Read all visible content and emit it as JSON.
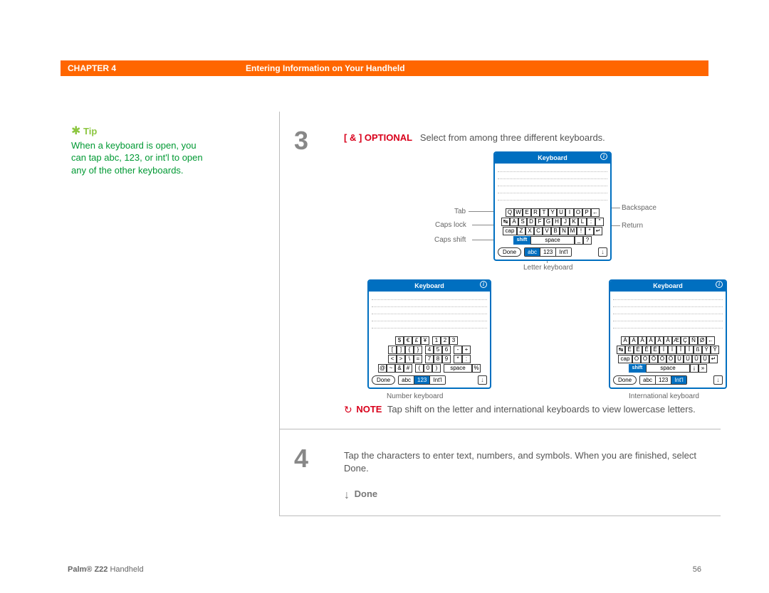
{
  "header": {
    "chapter": "CHAPTER 4",
    "title": "Entering Information on Your Handheld"
  },
  "tip": {
    "star": "✱",
    "label": "Tip",
    "text": "When a keyboard is open, you can tap abc, 123, or int'l to open any of the other keyboards."
  },
  "steps": {
    "s3": {
      "num": "3",
      "optional_tag": "[ & ]  OPTIONAL",
      "optional_text": "Select from among three different keyboards.",
      "callouts": {
        "tab": "Tab",
        "caps_lock": "Caps lock",
        "caps_shift": "Caps shift",
        "backspace": "Backspace",
        "return": "Return",
        "letter_kbd": "Letter keyboard",
        "number_kbd": "Number keyboard",
        "intl_kbd": "International keyboard"
      },
      "kb_title": "Keyboard",
      "kb1": {
        "rows": [
          [
            "Q",
            "W",
            "E",
            "R",
            "T",
            "Y",
            "U",
            "I",
            "O",
            "P",
            "←"
          ],
          [
            "↹",
            "A",
            "S",
            "D",
            "F",
            "G",
            "H",
            "J",
            "K",
            "L",
            ":",
            "\""
          ],
          [
            "cap",
            "Z",
            "X",
            "C",
            "V",
            "B",
            "N",
            "M",
            "!",
            "*",
            "↵"
          ]
        ],
        "shift": "shift",
        "space": "space",
        "trail": [
          "_",
          "?"
        ],
        "done": "Done",
        "seg": [
          "abc",
          "123",
          "Int'l"
        ],
        "active": 0
      },
      "kb2": {
        "rows": [
          [
            "$",
            "€",
            "£",
            "¥",
            "",
            "1",
            "2",
            "3",
            "",
            ""
          ],
          [
            "[",
            "]",
            "{",
            "}",
            "",
            "4",
            "5",
            "6",
            "",
            "-",
            "+"
          ],
          [
            "<",
            ">",
            "\\",
            "=",
            "",
            "7",
            "8",
            "9",
            "",
            "*",
            ":"
          ],
          [
            "@",
            "~",
            "&",
            "#",
            "",
            "(",
            "0",
            ")",
            "",
            "space",
            "%"
          ]
        ],
        "done": "Done",
        "seg": [
          "abc",
          "123",
          "Int'l"
        ],
        "active": 1
      },
      "kb3": {
        "rows": [
          [
            "Á",
            "À",
            "Â",
            "Ä",
            "Ã",
            "Å",
            "Æ",
            "Ç",
            "Ñ",
            "Ø",
            "←"
          ],
          [
            "↹",
            "É",
            "È",
            "Ê",
            "Ë",
            "Í",
            "Ì",
            "Î",
            "Ï",
            "ß",
            "Ý",
            "Ÿ"
          ],
          [
            "cap",
            "Ó",
            "Ò",
            "Ô",
            "Ö",
            "Õ",
            "Ú",
            "Ù",
            "Û",
            "Ü",
            "↵"
          ]
        ],
        "shift": "shift",
        "space": "space",
        "trail": [
          "¡",
          "»"
        ],
        "done": "Done",
        "seg": [
          "abc",
          "123",
          "Int'l"
        ],
        "active": 2
      },
      "note_icon": "↻",
      "note_tag": "NOTE",
      "note_text": "Tap shift on the letter and international keyboards to view lowercase letters."
    },
    "s4": {
      "num": "4",
      "text": "Tap the characters to enter text, numbers, and symbols. When you are finished, select Done.",
      "done_arrow": "↓",
      "done_label": "Done"
    }
  },
  "footer": {
    "product_bold": "Palm® Z22",
    "product_rest": " Handheld",
    "page": "56"
  }
}
